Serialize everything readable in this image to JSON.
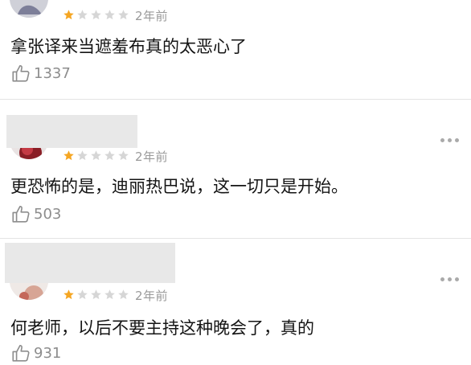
{
  "comments": [
    {
      "rating": 1,
      "max_rating": 5,
      "age": "2年前",
      "text": "拿张译来当遮羞布真的太恶心了",
      "likes": "1337",
      "like_icon": "thumbs-up-icon"
    },
    {
      "rating": 1,
      "max_rating": 5,
      "age": "2年前",
      "text": "更恐怖的是，迪丽热巴说，这一切只是开始。",
      "likes": "503",
      "like_icon": "thumbs-up-icon"
    },
    {
      "rating": 1,
      "max_rating": 5,
      "age": "2年前",
      "text": "何老师，以后不要主持这种晚会了，真的",
      "likes": "931",
      "like_icon": "thumbs-up-icon"
    }
  ],
  "colors": {
    "star_filled": "#f5a623",
    "star_empty": "#d6d6d6",
    "muted_text": "#9a9a9a"
  }
}
